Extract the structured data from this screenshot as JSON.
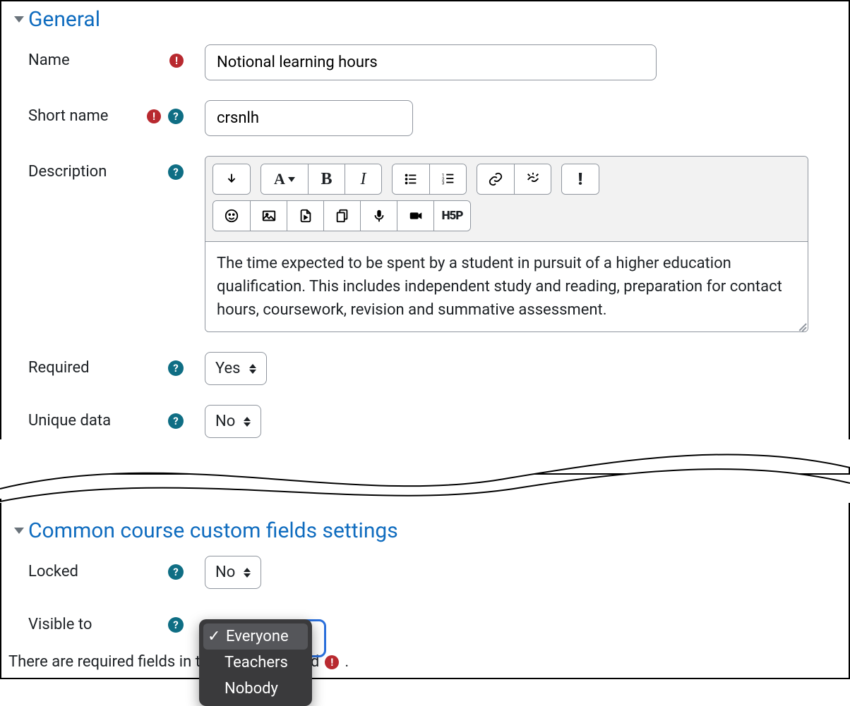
{
  "sections": {
    "general": {
      "title": "General"
    },
    "common": {
      "title": "Common course custom fields settings"
    }
  },
  "fields": {
    "name": {
      "label": "Name",
      "value": "Notional learning hours"
    },
    "shortname": {
      "label": "Short name",
      "value": "crsnlh"
    },
    "description": {
      "label": "Description",
      "value": "The time expected to be spent by a student in pursuit of a higher education qualification. This includes independent study and reading, preparation for contact hours, coursework, revision and summative assessment."
    },
    "required": {
      "label": "Required",
      "value": "Yes"
    },
    "uniquedata": {
      "label": "Unique data",
      "value": "No"
    },
    "locked": {
      "label": "Locked",
      "value": "No"
    },
    "visibleto": {
      "label": "Visible to",
      "options": [
        "Everyone",
        "Teachers",
        "Nobody"
      ],
      "selected": "Everyone"
    }
  },
  "footer": {
    "text_before": "There are required fields in t",
    "text_after": "d",
    "dot": "."
  },
  "toolbar_icons": {
    "row1": [
      "toggle-toolbar-icon",
      "font-style-icon",
      "bold-icon",
      "italic-icon",
      "bullet-list-icon",
      "number-list-icon",
      "link-icon",
      "unlink-icon",
      "alert-icon"
    ],
    "row2": [
      "emoji-icon",
      "image-icon",
      "media-icon",
      "files-icon",
      "microphone-icon",
      "video-icon",
      "h5p-icon"
    ]
  }
}
